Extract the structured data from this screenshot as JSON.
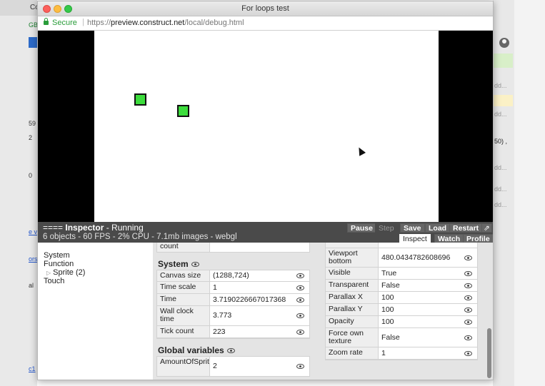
{
  "window": {
    "title": "For loops test",
    "secure_label": "Secure",
    "url_scheme": "https://",
    "url_host": "preview.construct.net",
    "url_path": "/local/debug.html"
  },
  "inspector": {
    "marks": "====",
    "name": "Inspector",
    "state": " - Running",
    "stats": "6 objects - 60 FPS - 2% CPU - 7.1mb images - webgl",
    "buttons": {
      "pause": "Pause",
      "step": "Step",
      "save": "Save",
      "load": "Load",
      "restart": "Restart",
      "popout": "⇗"
    },
    "tabs": {
      "inspect": "Inspect",
      "watch": "Watch",
      "profile": "Profile"
    }
  },
  "tree": {
    "system": "System",
    "function": "Function",
    "sprite": "Sprite (2)",
    "touch": "Touch"
  },
  "mid_panel": {
    "partial_row_label": "count",
    "system_title": "System",
    "system_rows": [
      {
        "label": "Canvas size",
        "value": "(1288,724)"
      },
      {
        "label": "Time scale",
        "value": "1"
      },
      {
        "label": "Time",
        "value": "3.7190226667017368"
      },
      {
        "label": "Wall clock time",
        "value": "3.773"
      },
      {
        "label": "Tick count",
        "value": "223"
      }
    ],
    "globals_title": "Global variables",
    "global_rows": [
      {
        "label": "AmountOfSpritesToSpawn",
        "value": "2"
      }
    ]
  },
  "layout_rows": [
    {
      "label": "Viewport bottom",
      "value": "480.0434782608696"
    },
    {
      "label": "Visible",
      "value": "True"
    },
    {
      "label": "Transparent",
      "value": "False"
    },
    {
      "label": "Parallax X",
      "value": "100"
    },
    {
      "label": "Parallax Y",
      "value": "100"
    },
    {
      "label": "Opacity",
      "value": "100"
    },
    {
      "label": "Force own texture",
      "value": "False"
    },
    {
      "label": "Zoom rate",
      "value": "1"
    }
  ],
  "background_left": {
    "tab_text": "Co",
    "fragments": [
      "GB]",
      "59",
      "2",
      "0",
      "e v",
      "ors",
      "al",
      "c1"
    ]
  },
  "background_right": {
    "fragments": [
      "dd...",
      "dd...",
      "50) ,",
      "dd...",
      "dd...",
      "dd..."
    ]
  },
  "colors": {
    "sprite_fill": "#3cdc3c",
    "inspector_bar": "#4a4a4a",
    "secure_green": "#2a9d3a"
  }
}
